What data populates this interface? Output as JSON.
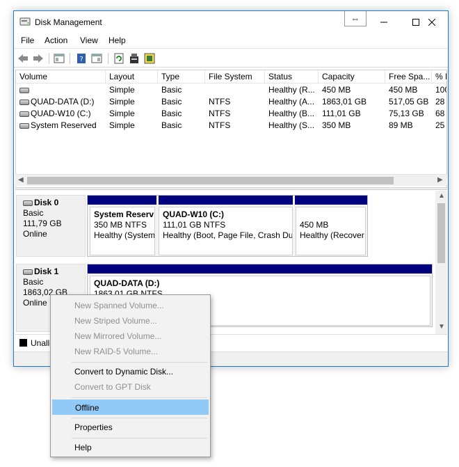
{
  "window": {
    "title": "Disk Management",
    "resize_hint": "⇔",
    "minimize": "—",
    "maximize": "☐",
    "close": "✕"
  },
  "menu": [
    "File",
    "Action",
    "View",
    "Help"
  ],
  "volumes": {
    "columns": [
      "Volume",
      "Layout",
      "Type",
      "File System",
      "Status",
      "Capacity",
      "Free Spa...",
      "% F"
    ],
    "rows": [
      [
        "",
        "Simple",
        "Basic",
        "",
        "Healthy (R...",
        "450 MB",
        "450 MB",
        "100"
      ],
      [
        "QUAD-DATA (D:)",
        "Simple",
        "Basic",
        "NTFS",
        "Healthy (A...",
        "1863,01 GB",
        "517,05 GB",
        "28"
      ],
      [
        "QUAD-W10 (C:)",
        "Simple",
        "Basic",
        "NTFS",
        "Healthy (B...",
        "111,01 GB",
        "75,13 GB",
        "68"
      ],
      [
        "System Reserved",
        "Simple",
        "Basic",
        "NTFS",
        "Healthy (S...",
        "350 MB",
        "89 MB",
        "25"
      ]
    ]
  },
  "disks": [
    {
      "name": "Disk 0",
      "type": "Basic",
      "size": "111,79 GB",
      "state": "Online",
      "partitions": [
        {
          "name": "System Reserv",
          "size": "350 MB NTFS",
          "status": "Healthy (System"
        },
        {
          "name": "QUAD-W10  (C:)",
          "size": "111,01 GB NTFS",
          "status": "Healthy (Boot, Page File, Crash Du"
        },
        {
          "name": "",
          "size": "450 MB",
          "status": "Healthy (Recover"
        }
      ]
    },
    {
      "name": "Disk 1",
      "type": "Basic",
      "size": "1863,02 GB",
      "state": "Online",
      "partitions": [
        {
          "name": "QUAD-DATA  (D:)",
          "size": "1863,01 GB NTFS",
          "status": "n)"
        }
      ]
    }
  ],
  "legend": {
    "unallocated": "Unallo"
  },
  "context_menu": {
    "items": [
      {
        "label": "New Spanned Volume...",
        "enabled": false
      },
      {
        "label": "New Striped Volume...",
        "enabled": false
      },
      {
        "label": "New Mirrored Volume...",
        "enabled": false
      },
      {
        "label": "New RAID-5 Volume...",
        "enabled": false
      },
      {
        "label": "Convert to Dynamic Disk...",
        "enabled": true
      },
      {
        "label": "Convert to GPT Disk",
        "enabled": false
      },
      {
        "label": "Offline",
        "enabled": true,
        "highlighted": true
      },
      {
        "label": "Properties",
        "enabled": true
      },
      {
        "label": "Help",
        "enabled": true
      }
    ]
  },
  "colors": {
    "partition_bar": "#00007f",
    "highlight": "#91c9f7",
    "border": "#1a7ad4"
  }
}
